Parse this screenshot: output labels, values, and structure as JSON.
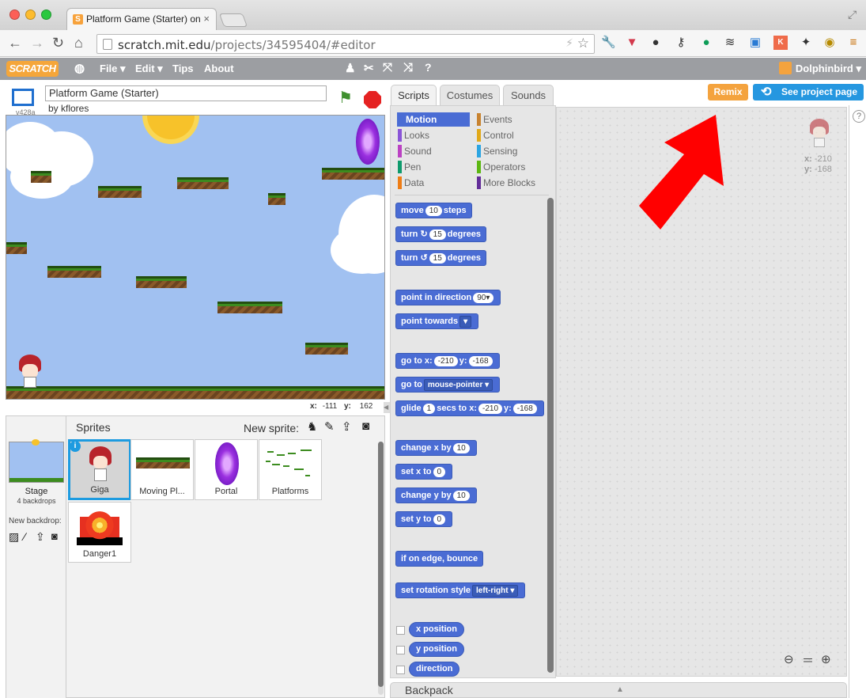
{
  "browser": {
    "tab_title": "Platform Game (Starter) on",
    "tab_close": "×",
    "url_host": "scratch.mit.edu",
    "url_path": "/projects/34595404/#editor"
  },
  "menubar": {
    "logo": "SCRATCH",
    "file": "File ▾",
    "edit": "Edit ▾",
    "tips": "Tips",
    "about": "About",
    "user": "Dolphinbird ▾"
  },
  "project": {
    "version": "v428a",
    "title": "Platform Game (Starter)",
    "author": "by kflores"
  },
  "stage": {
    "mouse_x_label": "x:",
    "mouse_x": "-111",
    "mouse_y_label": "y:",
    "mouse_y": "162"
  },
  "sprites_panel": {
    "stage_label": "Stage",
    "backdrops": "4 backdrops",
    "new_backdrop": "New backdrop:",
    "sprites_header": "Sprites",
    "new_sprite": "New sprite:",
    "sprites": [
      "Giga",
      "Moving Pl...",
      "Portal",
      "Platforms",
      "Danger1"
    ]
  },
  "tabs": [
    "Scripts",
    "Costumes",
    "Sounds"
  ],
  "buttons": {
    "remix": "Remix",
    "see_project": "See project page"
  },
  "categories": {
    "left": [
      "Motion",
      "Looks",
      "Sound",
      "Pen",
      "Data"
    ],
    "right": [
      "Events",
      "Control",
      "Sensing",
      "Operators",
      "More Blocks"
    ],
    "colors": {
      "Motion": "#4a6cd4",
      "Looks": "#8a55d7",
      "Sound": "#bb42c3",
      "Pen": "#0e9a6c",
      "Data": "#ee7d16",
      "Events": "#c88330",
      "Control": "#e1a91a",
      "Sensing": "#2ca5e2",
      "Operators": "#5cb712",
      "More Blocks": "#632d99"
    }
  },
  "blocks": {
    "move": [
      "move",
      "10",
      "steps"
    ],
    "turn_cw": [
      "turn",
      "15",
      "degrees"
    ],
    "turn_ccw": [
      "turn",
      "15",
      "degrees"
    ],
    "point_dir": [
      "point in direction",
      "90▾"
    ],
    "point_towards": [
      "point towards",
      "▾"
    ],
    "goto_xy": [
      "go to x:",
      "-210",
      "y:",
      "-168"
    ],
    "goto": [
      "go to",
      "mouse-pointer ▾"
    ],
    "glide": [
      "glide",
      "1",
      "secs to x:",
      "-210",
      "y:",
      "-168"
    ],
    "change_x": [
      "change x by",
      "10"
    ],
    "set_x": [
      "set x to",
      "0"
    ],
    "change_y": [
      "change y by",
      "10"
    ],
    "set_y": [
      "set y to",
      "0"
    ],
    "bounce": "if on edge, bounce",
    "rot_style": [
      "set rotation style",
      "left-right ▾"
    ],
    "reporters": [
      "x position",
      "y position",
      "direction"
    ]
  },
  "script_area": {
    "x_label": "x:",
    "x": "-210",
    "y_label": "y:",
    "y": "-168"
  },
  "backpack": "Backpack"
}
